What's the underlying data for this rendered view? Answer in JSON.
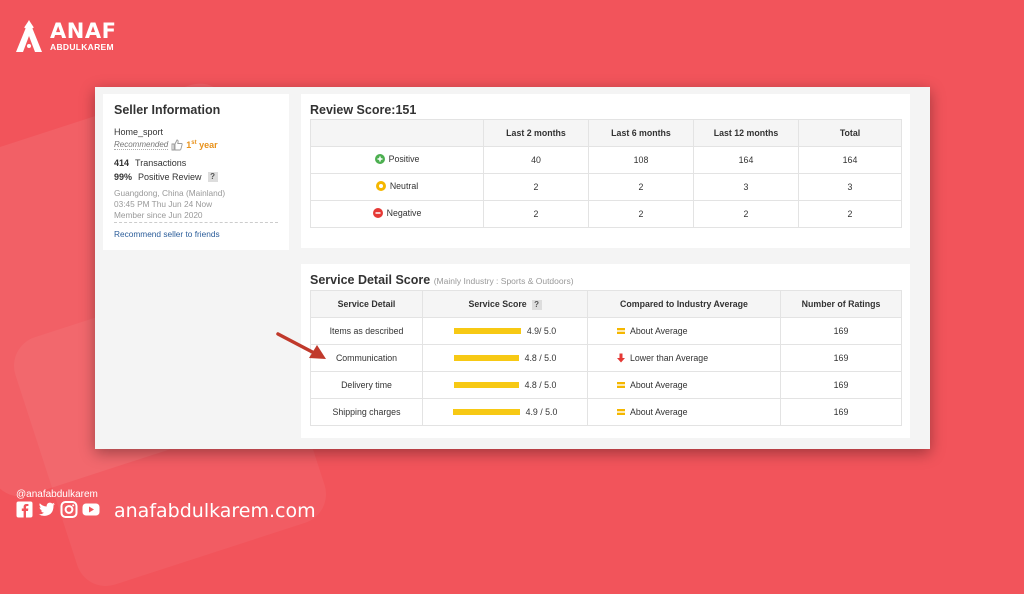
{
  "brand": {
    "name": "ANAF",
    "sub": "ABDULKAREM"
  },
  "footer": {
    "handle": "@anafabdulkarem",
    "site": "anafabdulkarem.com",
    "socials": [
      "facebook-icon",
      "twitter-icon",
      "instagram-icon",
      "youtube-icon"
    ]
  },
  "seller": {
    "title": "Seller Information",
    "name": "Home_sport",
    "recommended": "Recommended",
    "year_prefix": "1",
    "year_sup": "st",
    "year_suffix": " year",
    "transactions_count": "414",
    "transactions_label": "Transactions",
    "positive_pct": "99%",
    "positive_label": "Positive Review",
    "help": "?",
    "location": "Guangdong, China (Mainland)",
    "time": "03:45 PM Thu Jun 24 Now",
    "member": "Member since Jun 2020",
    "recommend_link": "Recommend seller to friends"
  },
  "review": {
    "title": "Review Score:151",
    "headers": [
      "",
      "Last 2 months",
      "Last 6 months",
      "Last 12 months",
      "Total"
    ],
    "rows": [
      {
        "label": "Positive",
        "icon": "plus-circle-icon",
        "color": "#4caf50",
        "values": [
          "40",
          "108",
          "164",
          "164"
        ]
      },
      {
        "label": "Neutral",
        "icon": "neutral-circle-icon",
        "color": "#f5b700",
        "values": [
          "2",
          "2",
          "3",
          "3"
        ]
      },
      {
        "label": "Negative",
        "icon": "minus-circle-icon",
        "color": "#e53935",
        "values": [
          "2",
          "2",
          "2",
          "2"
        ]
      }
    ]
  },
  "service": {
    "title": "Service Detail Score",
    "subtitle": "(Mainly Industry : Sports & Outdoors)",
    "headers": [
      "Service Detail",
      "Service Score",
      "Compared to Industry Average",
      "Number of Ratings"
    ],
    "help": "?",
    "rows": [
      {
        "detail": "Items as described",
        "score": 4.9,
        "score_text": "4.9/ 5.0",
        "compare": "About Average",
        "compare_icon": "equal-icon",
        "ratings": "169"
      },
      {
        "detail": "Communication",
        "score": 4.8,
        "score_text": "4.8 / 5.0",
        "compare": "Lower than Average",
        "compare_icon": "down-arrow-icon",
        "ratings": "169"
      },
      {
        "detail": "Delivery time",
        "score": 4.8,
        "score_text": "4.8 / 5.0",
        "compare": "About Average",
        "compare_icon": "equal-icon",
        "ratings": "169"
      },
      {
        "detail": "Shipping charges",
        "score": 4.9,
        "score_text": "4.9 / 5.0",
        "compare": "About Average",
        "compare_icon": "equal-icon",
        "ratings": "169"
      }
    ]
  },
  "colors": {
    "background": "#f2545b",
    "bar": "#f7c914",
    "lower": "#e53935",
    "equal": "#f5b700"
  }
}
